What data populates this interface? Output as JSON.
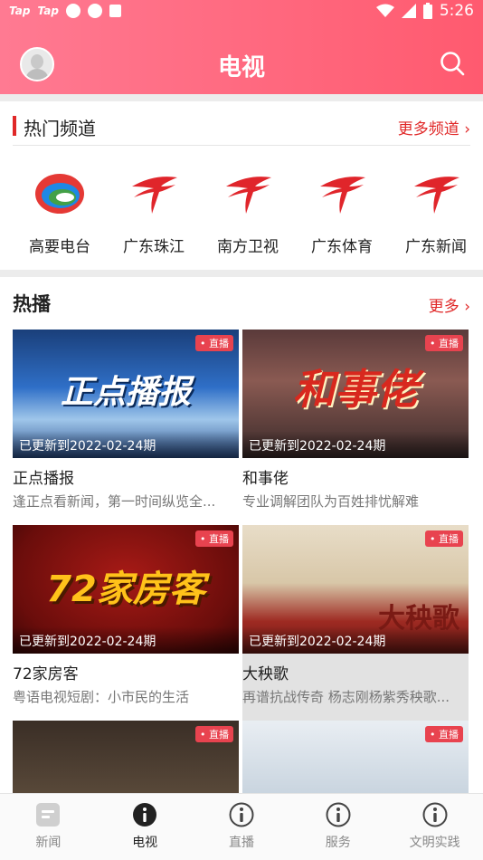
{
  "status": {
    "left_text_1": "Tap",
    "left_text_2": "Tap",
    "time": "5:26"
  },
  "header": {
    "title": "电视"
  },
  "channels_section": {
    "title": "热门频道",
    "more": "更多频道 ›",
    "items": [
      {
        "name": "高要电台",
        "logo": "gaoyao-logo-icon"
      },
      {
        "name": "广东珠江",
        "logo": "gdtv-logo-icon"
      },
      {
        "name": "南方卫视",
        "logo": "gdtv-logo-icon"
      },
      {
        "name": "广东体育",
        "logo": "gdtv-logo-icon"
      },
      {
        "name": "广东新闻",
        "logo": "gdtv-logo-icon"
      }
    ]
  },
  "hot_section": {
    "title": "热播",
    "more": "更多 ›",
    "live_label": "• 直播",
    "cards": [
      {
        "thumb_text": "正点播报",
        "update": "已更新到2022-02-24期",
        "title": "正点播报",
        "desc": "逢正点看新闻，第一时间纵览全..."
      },
      {
        "thumb_text": "和事佬",
        "update": "已更新到2022-02-24期",
        "title": "和事佬",
        "desc": "专业调解团队为百姓排忧解难"
      },
      {
        "thumb_text": "72家房客",
        "update": "已更新到2022-02-24期",
        "title": "72家房客",
        "desc": "粤语电视短剧：小市民的生活"
      },
      {
        "thumb_text": "大秧歌",
        "update": "已更新到2022-02-24期",
        "title": "大秧歌",
        "desc": "再谱抗战传奇 杨志刚杨紫秀秧歌..."
      }
    ]
  },
  "bottom_nav": [
    {
      "label": "新闻",
      "icon": "news-icon"
    },
    {
      "label": "电视",
      "icon": "info-icon"
    },
    {
      "label": "直播",
      "icon": "info-icon"
    },
    {
      "label": "服务",
      "icon": "info-icon"
    },
    {
      "label": "文明实践",
      "icon": "info-icon"
    }
  ],
  "colors": {
    "accent": "#e02828",
    "header_start": "#ff7a92",
    "header_end": "#ff5a6f",
    "live": "#e8434f"
  }
}
